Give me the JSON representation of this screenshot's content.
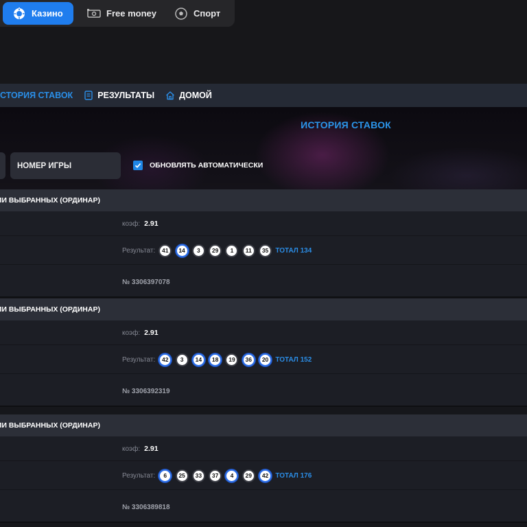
{
  "tabs": [
    {
      "label": "Казино",
      "icon": "casino-icon",
      "active": true
    },
    {
      "label": "Free money",
      "icon": "money-icon",
      "active": false
    },
    {
      "label": "Спорт",
      "icon": "soccer-ball-icon",
      "active": false
    }
  ],
  "nav": {
    "history": "ИСТОРИЯ СТАВОК",
    "results": "РЕЗУЛЬТАТЫ",
    "home": "ДОМОЙ"
  },
  "banner": {
    "title": "ИСТОРИЯ СТАВОК",
    "game_number_placeholder": "НОМЕР ИГРЫ",
    "auto_update_label": "ОБНОВЛЯТЬ АВТОМАТИЧЕСКИ",
    "auto_update_checked": true
  },
  "bets": [
    {
      "title": "ЛИ ВЫБРАННЫХ (ОРДИНАР)",
      "coef_label": "коэф:",
      "coef": "2.91",
      "result_label": "Результат:",
      "balls": [
        {
          "n": "41",
          "hl": false
        },
        {
          "n": "14",
          "hl": true
        },
        {
          "n": "3",
          "hl": false
        },
        {
          "n": "29",
          "hl": false
        },
        {
          "n": "1",
          "hl": false
        },
        {
          "n": "11",
          "hl": false
        },
        {
          "n": "35",
          "hl": false
        }
      ],
      "total": "ТОТАЛ 134",
      "number": "№ 3306397078"
    },
    {
      "title": "ЛИ ВЫБРАННЫХ (ОРДИНАР)",
      "coef_label": "коэф:",
      "coef": "2.91",
      "result_label": "Результат:",
      "balls": [
        {
          "n": "42",
          "hl": true
        },
        {
          "n": "3",
          "hl": false
        },
        {
          "n": "14",
          "hl": true
        },
        {
          "n": "18",
          "hl": true
        },
        {
          "n": "19",
          "hl": false
        },
        {
          "n": "36",
          "hl": true
        },
        {
          "n": "20",
          "hl": true
        }
      ],
      "total": "ТОТАЛ 152",
      "number": "№ 3306392319"
    },
    {
      "title": "ЛИ ВЫБРАННЫХ (ОРДИНАР)",
      "coef_label": "коэф:",
      "coef": "2.91",
      "result_label": "Результат:",
      "balls": [
        {
          "n": "6",
          "hl": true
        },
        {
          "n": "25",
          "hl": false
        },
        {
          "n": "33",
          "hl": false
        },
        {
          "n": "37",
          "hl": false
        },
        {
          "n": "4",
          "hl": true
        },
        {
          "n": "29",
          "hl": false
        },
        {
          "n": "42",
          "hl": true
        }
      ],
      "total": "ТОТАЛ 176",
      "number": "№ 3306389818"
    }
  ],
  "colors": {
    "accent": "#1f7dee",
    "link": "#2b8de6",
    "highlight_ring": "#2d6fe8"
  }
}
